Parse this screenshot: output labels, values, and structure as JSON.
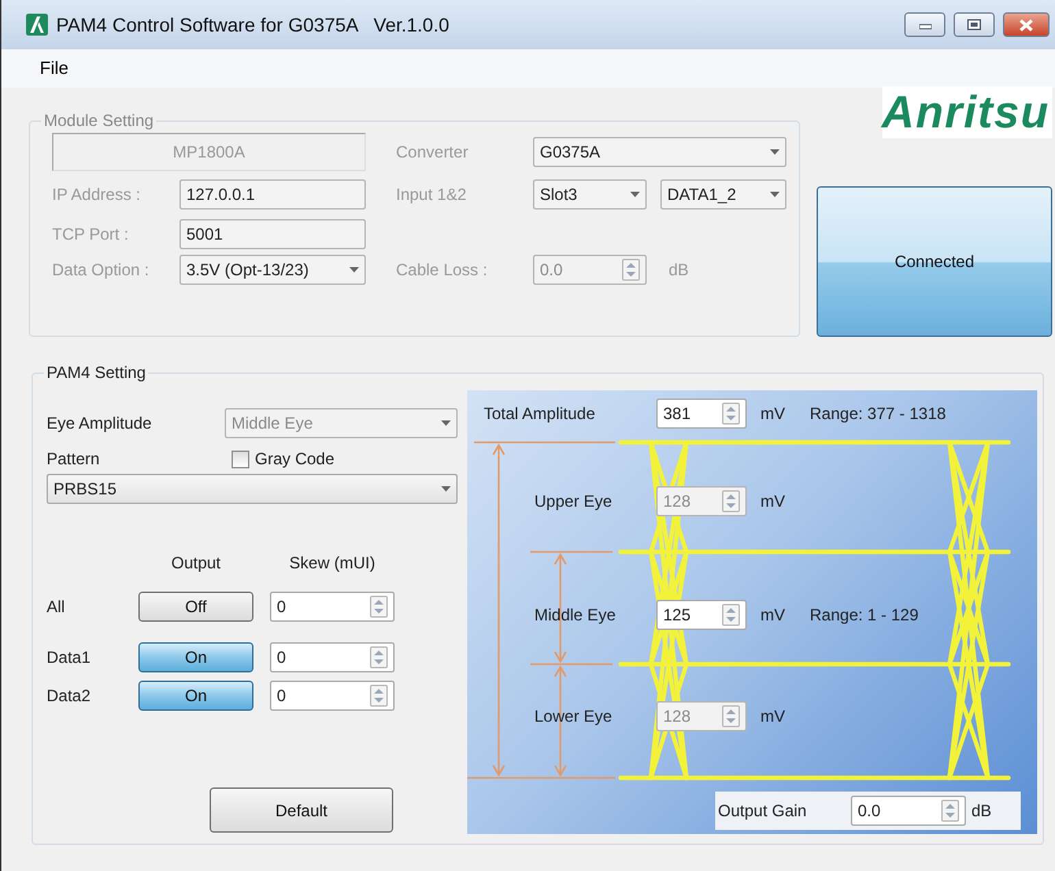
{
  "window": {
    "title": "PAM4 Control Software for G0375A   Ver.1.0.0"
  },
  "menu": [
    {
      "label": "File"
    }
  ],
  "module_setting": {
    "title": "Module Setting",
    "module": "MP1800A",
    "fields": [
      {
        "label": "IP Address :",
        "value": "127.0.0.1",
        "kind": "text"
      },
      {
        "label": "TCP Port :",
        "value": "5001",
        "kind": "text"
      },
      {
        "label": "Data Option :",
        "value": "3.5V (Opt-13/23)",
        "kind": "select"
      }
    ],
    "converter": {
      "label": "Converter",
      "value": "G0375A"
    },
    "input": {
      "label": "Input 1&2",
      "slot": "Slot3",
      "data": "DATA1_2"
    },
    "cable_loss": {
      "label": "Cable Loss :",
      "value": "0.0",
      "unit": "dB"
    }
  },
  "logo": "Anritsu",
  "connect_button": {
    "label": "Connected"
  },
  "pam4_setting": {
    "title": "PAM4 Setting",
    "eye_amplitude": {
      "label": "Eye Amplitude",
      "value": "Middle Eye",
      "disabled": true
    },
    "pattern": {
      "label": "Pattern",
      "value": "PRBS15"
    },
    "gray_code": {
      "label": "Gray Code",
      "checked": false
    },
    "output_header": "Output",
    "skew_header": "Skew (mUI)",
    "channels": [
      {
        "name": "All",
        "output": "Off",
        "on": false,
        "skew": "0"
      },
      {
        "name": "Data1",
        "output": "On",
        "on": true,
        "skew": "0"
      },
      {
        "name": "Data2",
        "output": "On",
        "on": true,
        "skew": "0"
      }
    ],
    "default_button": "Default",
    "diagram": {
      "total_amplitude": {
        "label": "Total Amplitude",
        "value": "381",
        "unit": "mV",
        "range": "Range: 377 - 1318"
      },
      "eyes": [
        {
          "label": "Upper Eye",
          "value": "128",
          "unit": "mV",
          "disabled": true
        },
        {
          "label": "Middle Eye",
          "value": "125",
          "unit": "mV",
          "disabled": false,
          "range": "Range: 1 - 129"
        },
        {
          "label": "Lower Eye",
          "value": "128",
          "unit": "mV",
          "disabled": true
        }
      ],
      "output_gain": {
        "label": "Output Gain",
        "value": "0.0",
        "unit": "dB"
      }
    }
  }
}
